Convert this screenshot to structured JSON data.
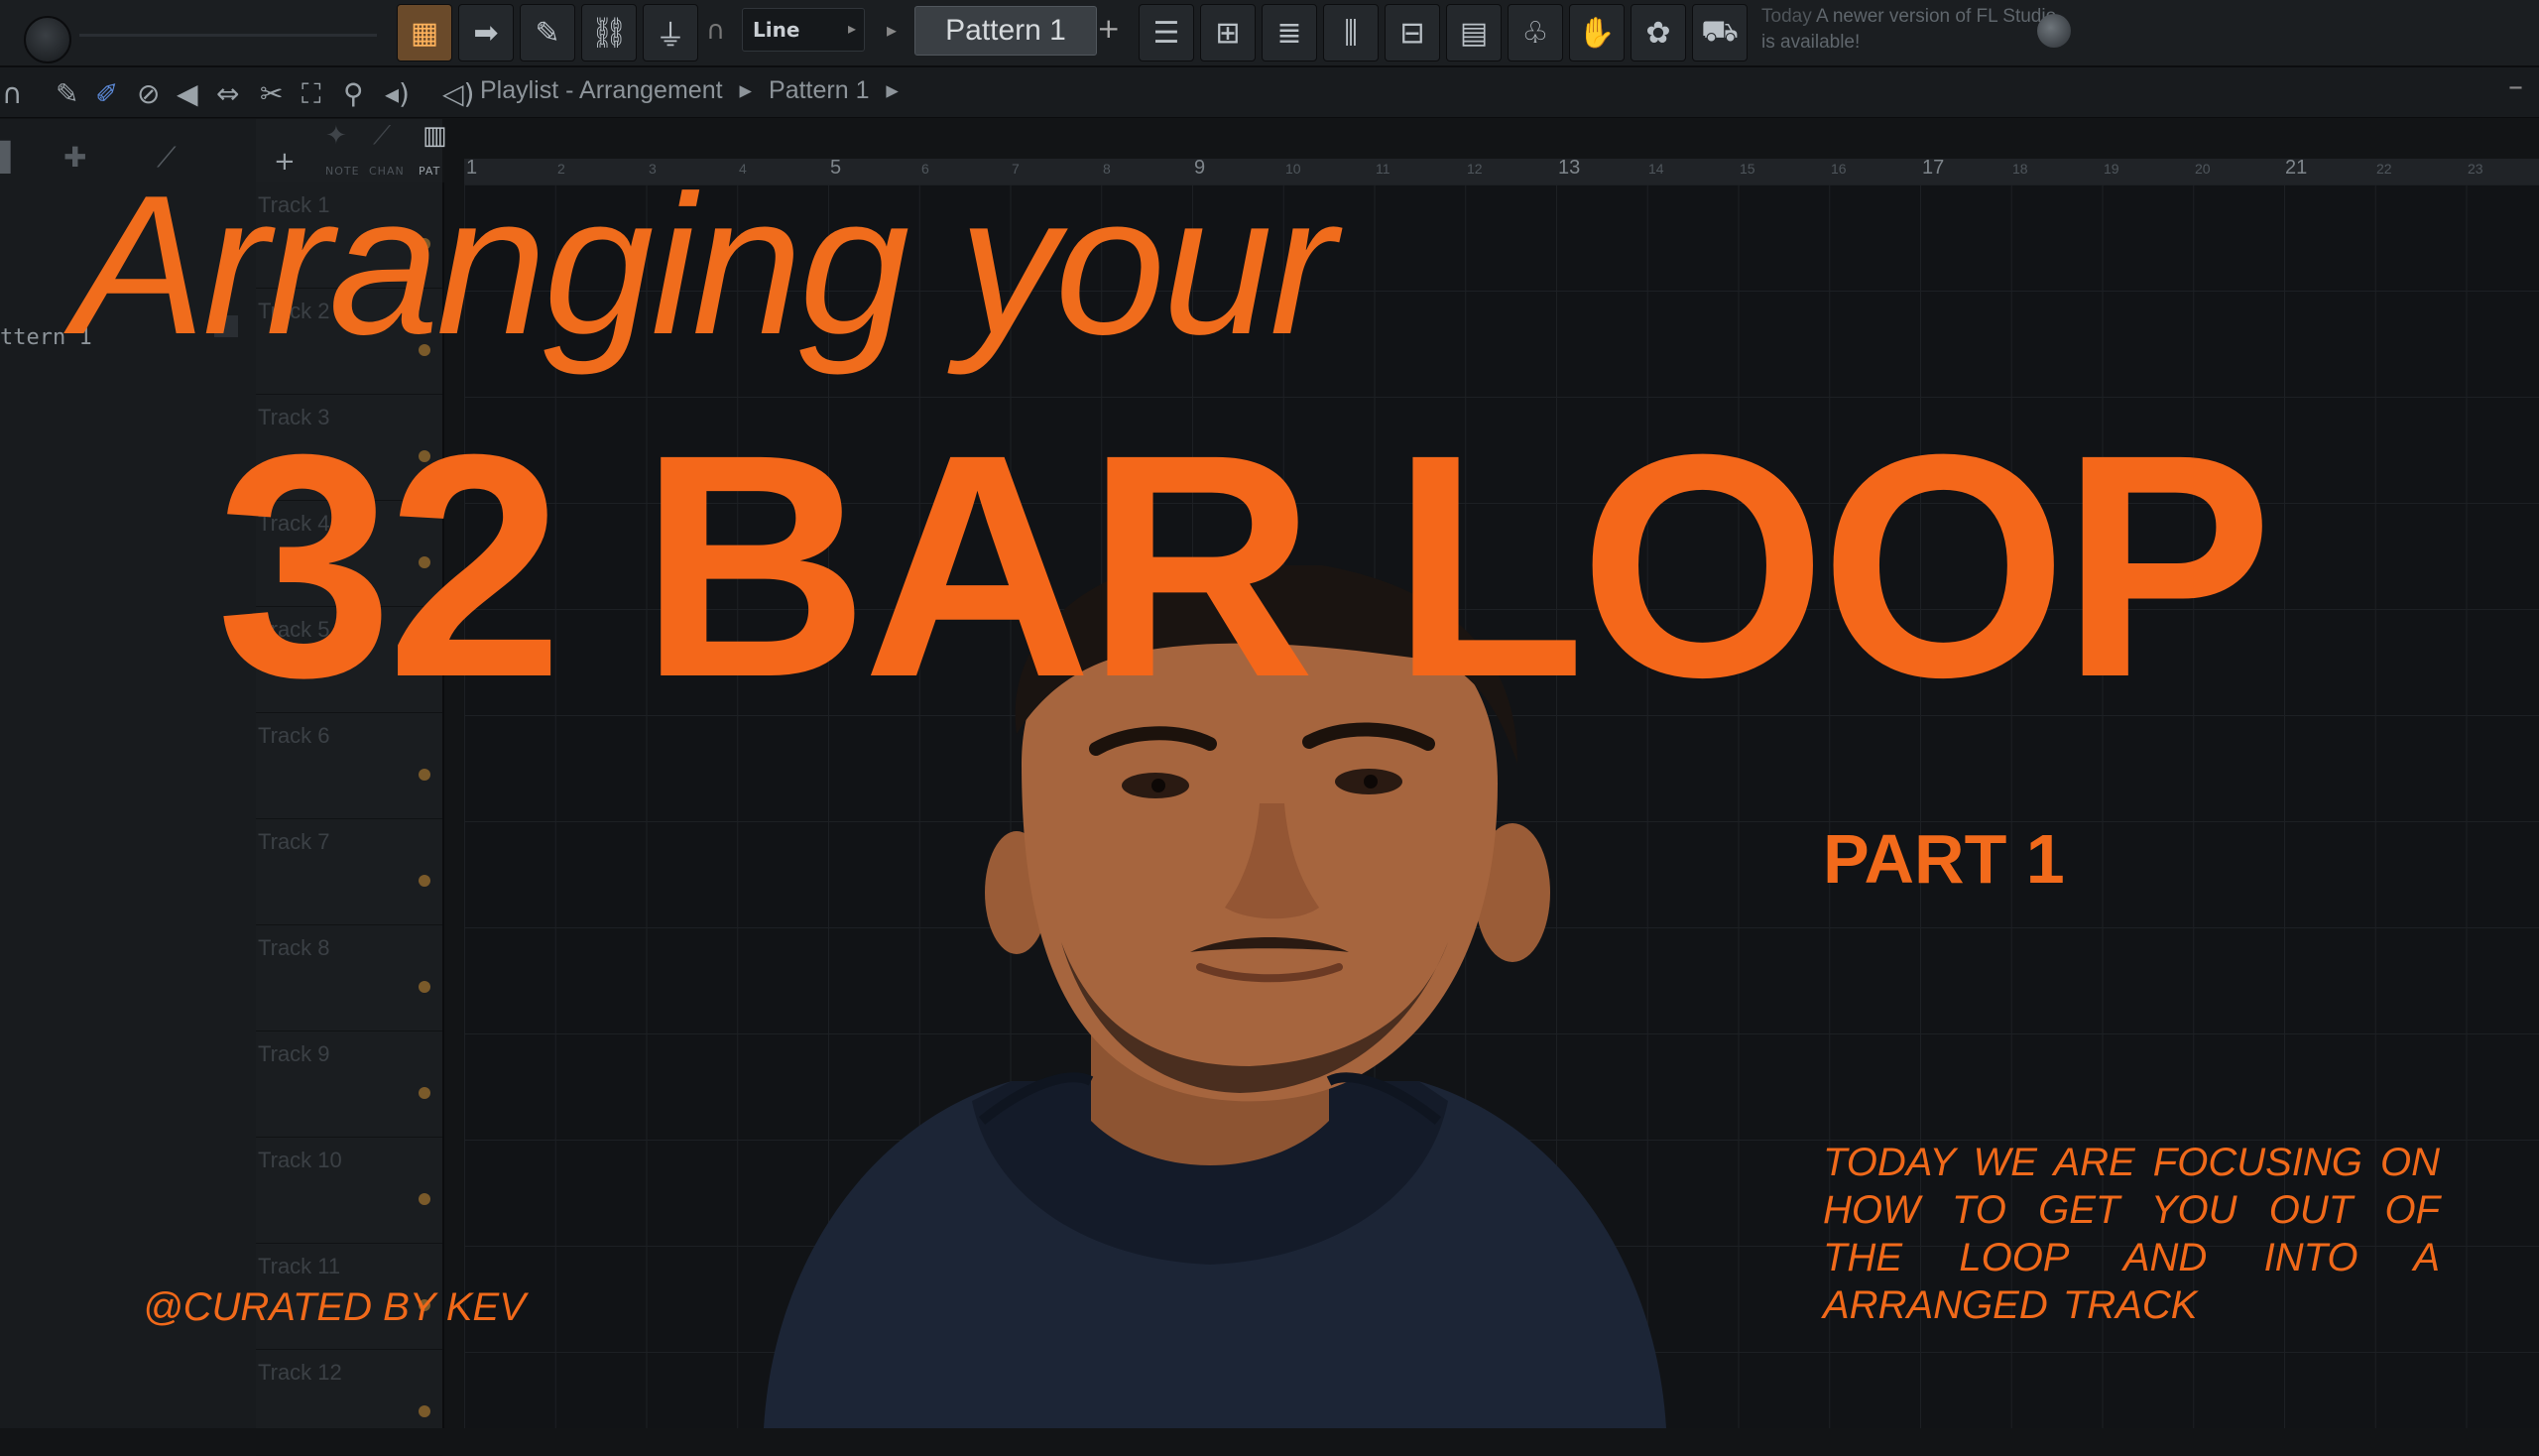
{
  "toolbar": {
    "snap_mode": "Line",
    "pattern": "Pattern 1",
    "news_label": "Today",
    "news_text": "A newer version of FL Studio is available!"
  },
  "playlist_bar": {
    "crumbs": [
      "Playlist - Arrangement",
      "Pattern 1"
    ]
  },
  "browser": {
    "pattern_item": "ttern 1",
    "tabs": [
      "NOTE",
      "CHAN",
      "PAT"
    ]
  },
  "tracks": [
    "Track 1",
    "Track 2",
    "Track 3",
    "Track 4",
    "Track 5",
    "Track 6",
    "Track 7",
    "Track 8",
    "Track 9",
    "Track 10",
    "Track 11",
    "Track 12"
  ],
  "ruler": [
    "1",
    "2",
    "3",
    "4",
    "5",
    "6",
    "7",
    "8",
    "9",
    "10",
    "11",
    "12",
    "13",
    "14",
    "15",
    "16",
    "17",
    "18",
    "19",
    "20",
    "21",
    "22",
    "23"
  ],
  "thumbnail": {
    "headline": "Arranging your",
    "big_title": "32 BAR LOOP",
    "part": "PART 1",
    "description": "TODAY WE ARE FOCUSING ON HOW TO GET YOU OUT OF THE LOOP AND INTO A ARRANGED TRACK",
    "credit": "@CURATED BY KEV"
  },
  "colors": {
    "accent_orange": "#f26a1b",
    "background": "#121416",
    "hoodie": "#1c2536",
    "skin": "#a0623d"
  }
}
